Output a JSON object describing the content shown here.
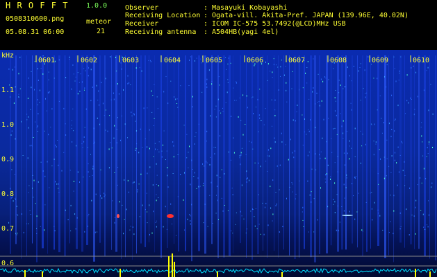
{
  "header": {
    "app_title": "H R O F F T",
    "version": "1.0.0",
    "filename": "0508310600.png",
    "datetime": "05.08.31 06:00",
    "meteor_label": "meteor",
    "meteor_count": "21",
    "info_labels": [
      "Observer",
      "Receiving Location",
      "Receiver",
      "Receiving antenna"
    ],
    "separator": ":",
    "info_values": [
      "Masayuki Kobayashi",
      "Ogata-vill. Akita-Pref. JAPAN (139.96E, 40.02N)",
      "ICOM IC-575 53.7492(@LCD)MHz USB",
      "A504HB(yagi 4el)"
    ]
  },
  "spectrogram": {
    "y_unit": "kHz",
    "y_ticks": [
      "1.1",
      "1.0",
      "0.9",
      "0.8",
      "0.7",
      "0.6"
    ],
    "time_labels": [
      "0601",
      "0602",
      "0603",
      "0604",
      "0605",
      "0606",
      "0607",
      "0608",
      "0609",
      "0610"
    ],
    "colors": {
      "label": "#ffff33",
      "text": "#7cff5a",
      "level_trace": "#00e0ff",
      "meteor": "#ffff00"
    }
  }
}
